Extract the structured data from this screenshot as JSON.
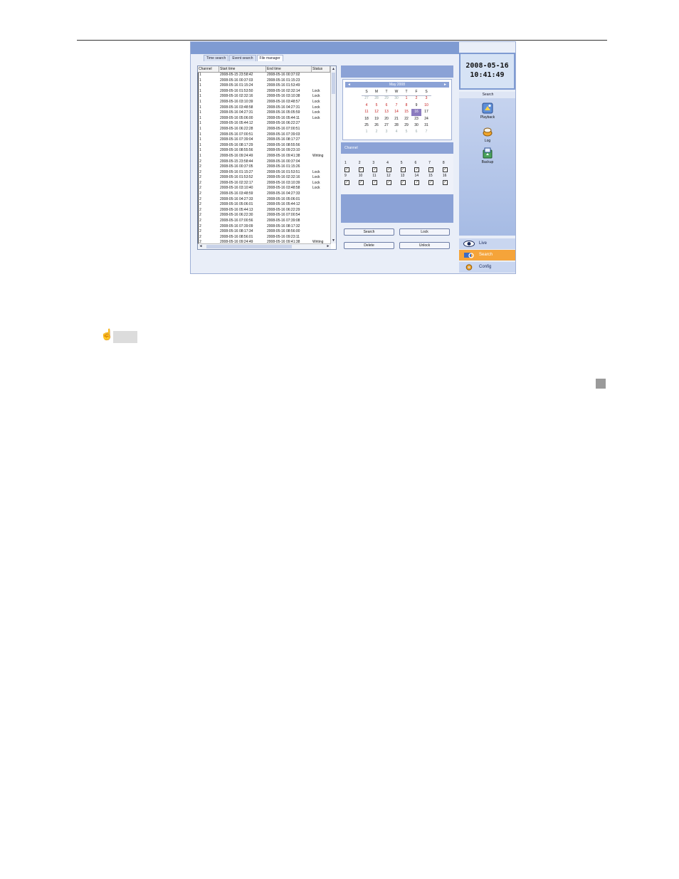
{
  "window": {
    "tabs": [
      "Time search",
      "Event search",
      "File manager"
    ],
    "active_tab": 2
  },
  "file_list": {
    "columns": [
      "Channel",
      "Start time",
      "End time",
      "Status"
    ],
    "rows": [
      [
        "1",
        "2008-05-15 23:58:42",
        "2008-05-16 00:37:02",
        ""
      ],
      [
        "1",
        "2008-05-16 00:37:03",
        "2008-05-16 01:15:23",
        ""
      ],
      [
        "1",
        "2008-05-16 01:15:24",
        "2008-05-16 01:53:49",
        ""
      ],
      [
        "1",
        "2008-05-16 01:53:50",
        "2008-05-16 02:32:14",
        "Lock"
      ],
      [
        "1",
        "2008-05-16 02:32:16",
        "2008-05-16 03:10:38",
        "Lock"
      ],
      [
        "1",
        "2008-05-16 03:10:39",
        "2008-05-16 03:48:57",
        "Lock"
      ],
      [
        "1",
        "2008-05-16 03:48:58",
        "2008-05-16 04:27:31",
        "Lock"
      ],
      [
        "1",
        "2008-05-16 04:27:31",
        "2008-05-16 05:05:59",
        "Lock"
      ],
      [
        "1",
        "2008-05-16 05:06:00",
        "2008-05-16 05:44:11",
        "Lock"
      ],
      [
        "1",
        "2008-05-16 05:44:12",
        "2008-05-16 06:22:27",
        ""
      ],
      [
        "1",
        "2008-05-16 06:22:28",
        "2008-05-16 07:00:51",
        ""
      ],
      [
        "1",
        "2008-05-16 07:00:51",
        "2008-05-16 07:39:03",
        ""
      ],
      [
        "1",
        "2008-05-16 07:39:04",
        "2008-05-16 08:17:27",
        ""
      ],
      [
        "1",
        "2008-05-16 08:17:29",
        "2008-05-16 08:55:56",
        ""
      ],
      [
        "1",
        "2008-05-16 08:55:56",
        "2008-05-16 09:23:10",
        ""
      ],
      [
        "1",
        "2008-05-16 09:24:49",
        "2008-05-16 09:41:38",
        "Writing"
      ],
      [
        "2",
        "2008-05-15 23:58:44",
        "2008-05-16 00:37:04",
        ""
      ],
      [
        "2",
        "2008-05-16 00:37:05",
        "2008-05-16 01:15:26",
        ""
      ],
      [
        "2",
        "2008-05-16 01:15:27",
        "2008-05-16 01:53:51",
        "Lock"
      ],
      [
        "2",
        "2008-05-16 01:53:52",
        "2008-05-16 02:32:16",
        "Lock"
      ],
      [
        "2",
        "2008-05-16 02:32:17",
        "2008-05-16 03:10:39",
        "Lock"
      ],
      [
        "2",
        "2008-05-16 03:10:40",
        "2008-05-16 03:48:58",
        "Lock"
      ],
      [
        "2",
        "2008-05-16 03:48:59",
        "2008-05-16 04:27:33",
        ""
      ],
      [
        "2",
        "2008-05-16 04:27:33",
        "2008-05-16 05:06:01",
        ""
      ],
      [
        "2",
        "2008-05-16 05:06:01",
        "2008-05-16 05:44:12",
        ""
      ],
      [
        "2",
        "2008-05-16 05:44:13",
        "2008-05-16 06:22:29",
        ""
      ],
      [
        "2",
        "2008-05-16 06:22:30",
        "2008-05-16 07:00:54",
        ""
      ],
      [
        "2",
        "2008-05-16 07:00:56",
        "2008-05-16 07:39:08",
        ""
      ],
      [
        "2",
        "2008-05-16 07:39:09",
        "2008-05-16 08:17:32",
        ""
      ],
      [
        "2",
        "2008-05-16 08:17:34",
        "2008-05-16 08:56:00",
        ""
      ],
      [
        "2",
        "2008-05-16 08:56:01",
        "2008-05-16 09:23:11",
        ""
      ],
      [
        "2",
        "2008-05-16 09:24:49",
        "2008-05-16 09:41:38",
        "Writing"
      ]
    ]
  },
  "calendar": {
    "month_label": "May 2008",
    "prev_icon": "◄",
    "next_icon": "►",
    "weekdays": [
      "S",
      "M",
      "T",
      "W",
      "T",
      "F",
      "S"
    ],
    "days": [
      {
        "d": "27",
        "t": "other"
      },
      {
        "d": "28",
        "t": "other"
      },
      {
        "d": "29",
        "t": "other"
      },
      {
        "d": "30",
        "t": "other"
      },
      {
        "d": "1",
        "t": "rec"
      },
      {
        "d": "2",
        "t": "rec"
      },
      {
        "d": "3",
        "t": "rec"
      },
      {
        "d": "4",
        "t": "rec"
      },
      {
        "d": "5",
        "t": "rec"
      },
      {
        "d": "6",
        "t": "rec"
      },
      {
        "d": "7",
        "t": "rec"
      },
      {
        "d": "8",
        "t": "rec"
      },
      {
        "d": "9",
        "t": ""
      },
      {
        "d": "10",
        "t": "rec"
      },
      {
        "d": "11",
        "t": "rec"
      },
      {
        "d": "12",
        "t": "rec"
      },
      {
        "d": "13",
        "t": "rec"
      },
      {
        "d": "14",
        "t": "rec"
      },
      {
        "d": "15",
        "t": "rec"
      },
      {
        "d": "16",
        "t": "sel"
      },
      {
        "d": "17",
        "t": ""
      },
      {
        "d": "18",
        "t": ""
      },
      {
        "d": "19",
        "t": ""
      },
      {
        "d": "20",
        "t": ""
      },
      {
        "d": "21",
        "t": ""
      },
      {
        "d": "22",
        "t": ""
      },
      {
        "d": "23",
        "t": ""
      },
      {
        "d": "24",
        "t": ""
      },
      {
        "d": "25",
        "t": ""
      },
      {
        "d": "26",
        "t": ""
      },
      {
        "d": "27",
        "t": ""
      },
      {
        "d": "28",
        "t": ""
      },
      {
        "d": "29",
        "t": ""
      },
      {
        "d": "30",
        "t": ""
      },
      {
        "d": "31",
        "t": ""
      },
      {
        "d": "1",
        "t": "other"
      },
      {
        "d": "2",
        "t": "other"
      },
      {
        "d": "3",
        "t": "other"
      },
      {
        "d": "4",
        "t": "other"
      },
      {
        "d": "5",
        "t": "other"
      },
      {
        "d": "6",
        "t": "other"
      },
      {
        "d": "7",
        "t": "other"
      }
    ]
  },
  "channel_panel": {
    "label": "Channel",
    "channels": [
      "1",
      "2",
      "3",
      "4",
      "5",
      "6",
      "7",
      "8",
      "9",
      "10",
      "11",
      "12",
      "13",
      "14",
      "15",
      "16"
    ],
    "check_mark": "✓"
  },
  "buttons": {
    "search": "Search",
    "lock": "Lock",
    "delete": "Delete",
    "unlock": "Unlock"
  },
  "clock": {
    "date": "2008-05-16",
    "time": "10:41:49"
  },
  "sidebar": {
    "header": "Search",
    "items": [
      {
        "label": "Playback",
        "icon": "playback-icon"
      },
      {
        "label": "Log",
        "icon": "log-icon"
      },
      {
        "label": "Backup",
        "icon": "backup-icon"
      }
    ]
  },
  "nav": {
    "live": "Live",
    "search": "Search",
    "config": "Config"
  },
  "colors": {
    "accent_blue": "#8ba2d6",
    "nav_active": "#f5a43a",
    "record_day": "#c41818"
  }
}
